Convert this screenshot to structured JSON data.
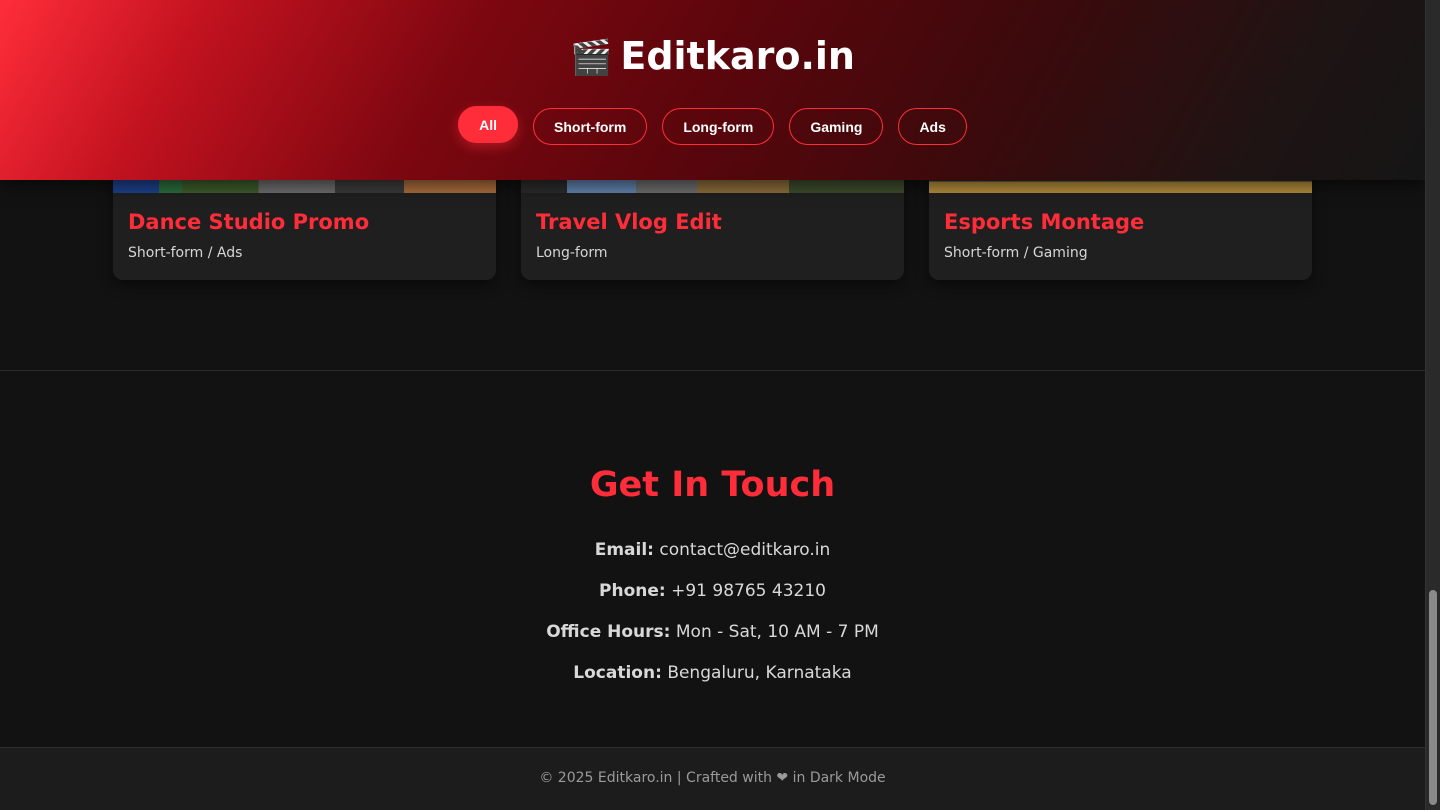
{
  "header": {
    "brand_icon": "🎬",
    "brand_name": "Editkaro.in",
    "filters": [
      {
        "label": "All",
        "active": true
      },
      {
        "label": "Short-form",
        "active": false
      },
      {
        "label": "Long-form",
        "active": false
      },
      {
        "label": "Gaming",
        "active": false
      },
      {
        "label": "Ads",
        "active": false
      }
    ]
  },
  "portfolio": {
    "cards": [
      {
        "title": "Dance Studio Promo",
        "tags": "Short-form / Ads"
      },
      {
        "title": "Travel Vlog Edit",
        "tags": "Long-form"
      },
      {
        "title": "Esports Montage",
        "tags": "Short-form / Gaming"
      }
    ]
  },
  "contact": {
    "title": "Get In Touch",
    "email_label": "Email:",
    "email_value": "contact@editkaro.in",
    "phone_label": "Phone:",
    "phone_value": "+91 98765 43210",
    "hours_label": "Office Hours:",
    "hours_value": "Mon - Sat, 10 AM - 7 PM",
    "location_label": "Location:",
    "location_value": "Bengaluru, Karnataka"
  },
  "footer": {
    "text": "© 2025 Editkaro.in | Crafted with ❤ in Dark Mode"
  },
  "colors": {
    "accent": "#ff2d3a",
    "background": "#121212",
    "card": "#1f1f1f"
  }
}
